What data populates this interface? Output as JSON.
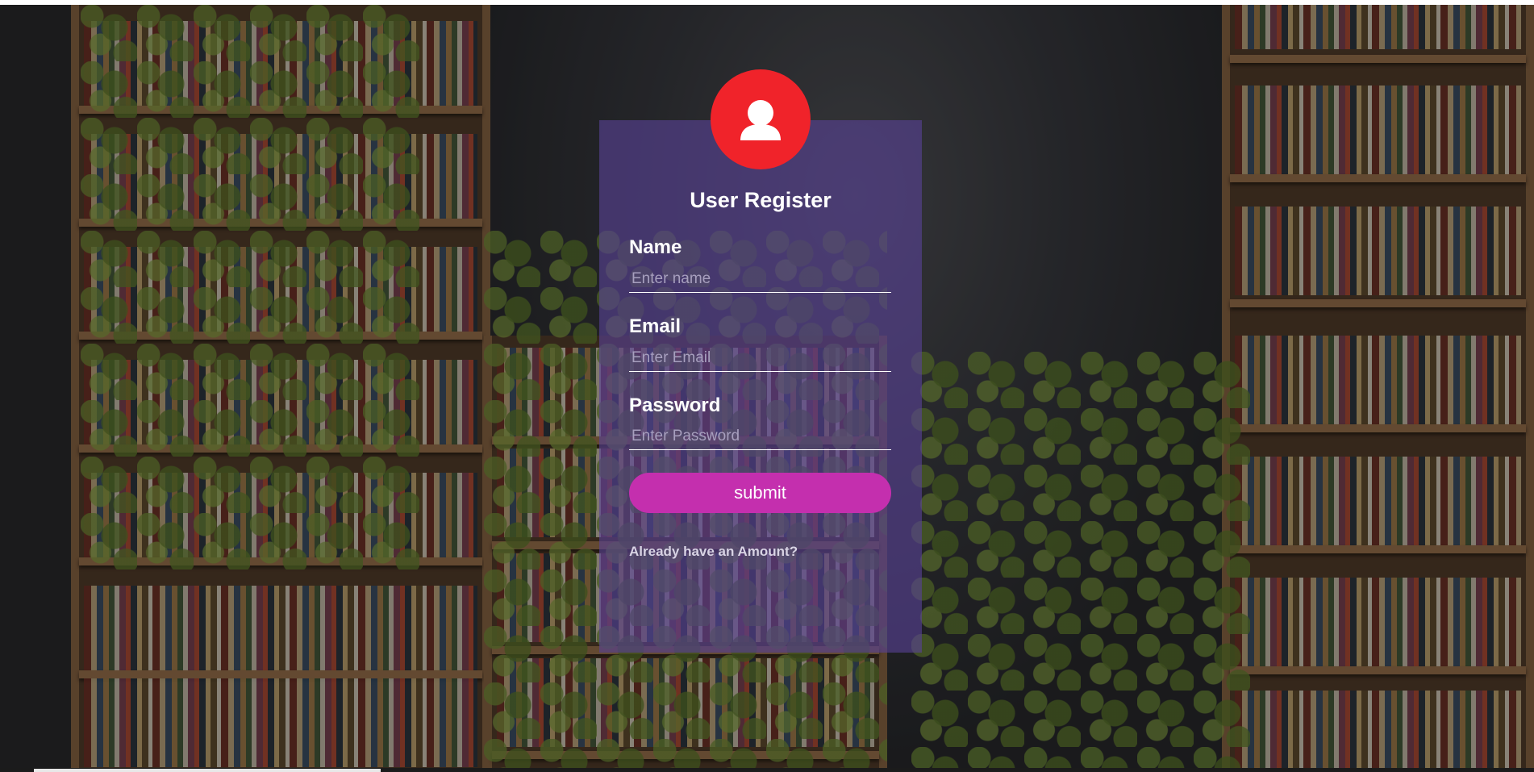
{
  "register": {
    "title": "User Register",
    "icon": "user-icon",
    "avatar_color": "#f0232a",
    "fields": [
      {
        "label": "Name",
        "placeholder": "Enter name",
        "value": ""
      },
      {
        "label": "Email",
        "placeholder": "Enter Email",
        "value": ""
      },
      {
        "label": "Password",
        "placeholder": "Enter Password",
        "value": ""
      }
    ],
    "submit_label": "submit",
    "submit_color": "#c42fae",
    "login_link": "Already have an Amount?"
  }
}
